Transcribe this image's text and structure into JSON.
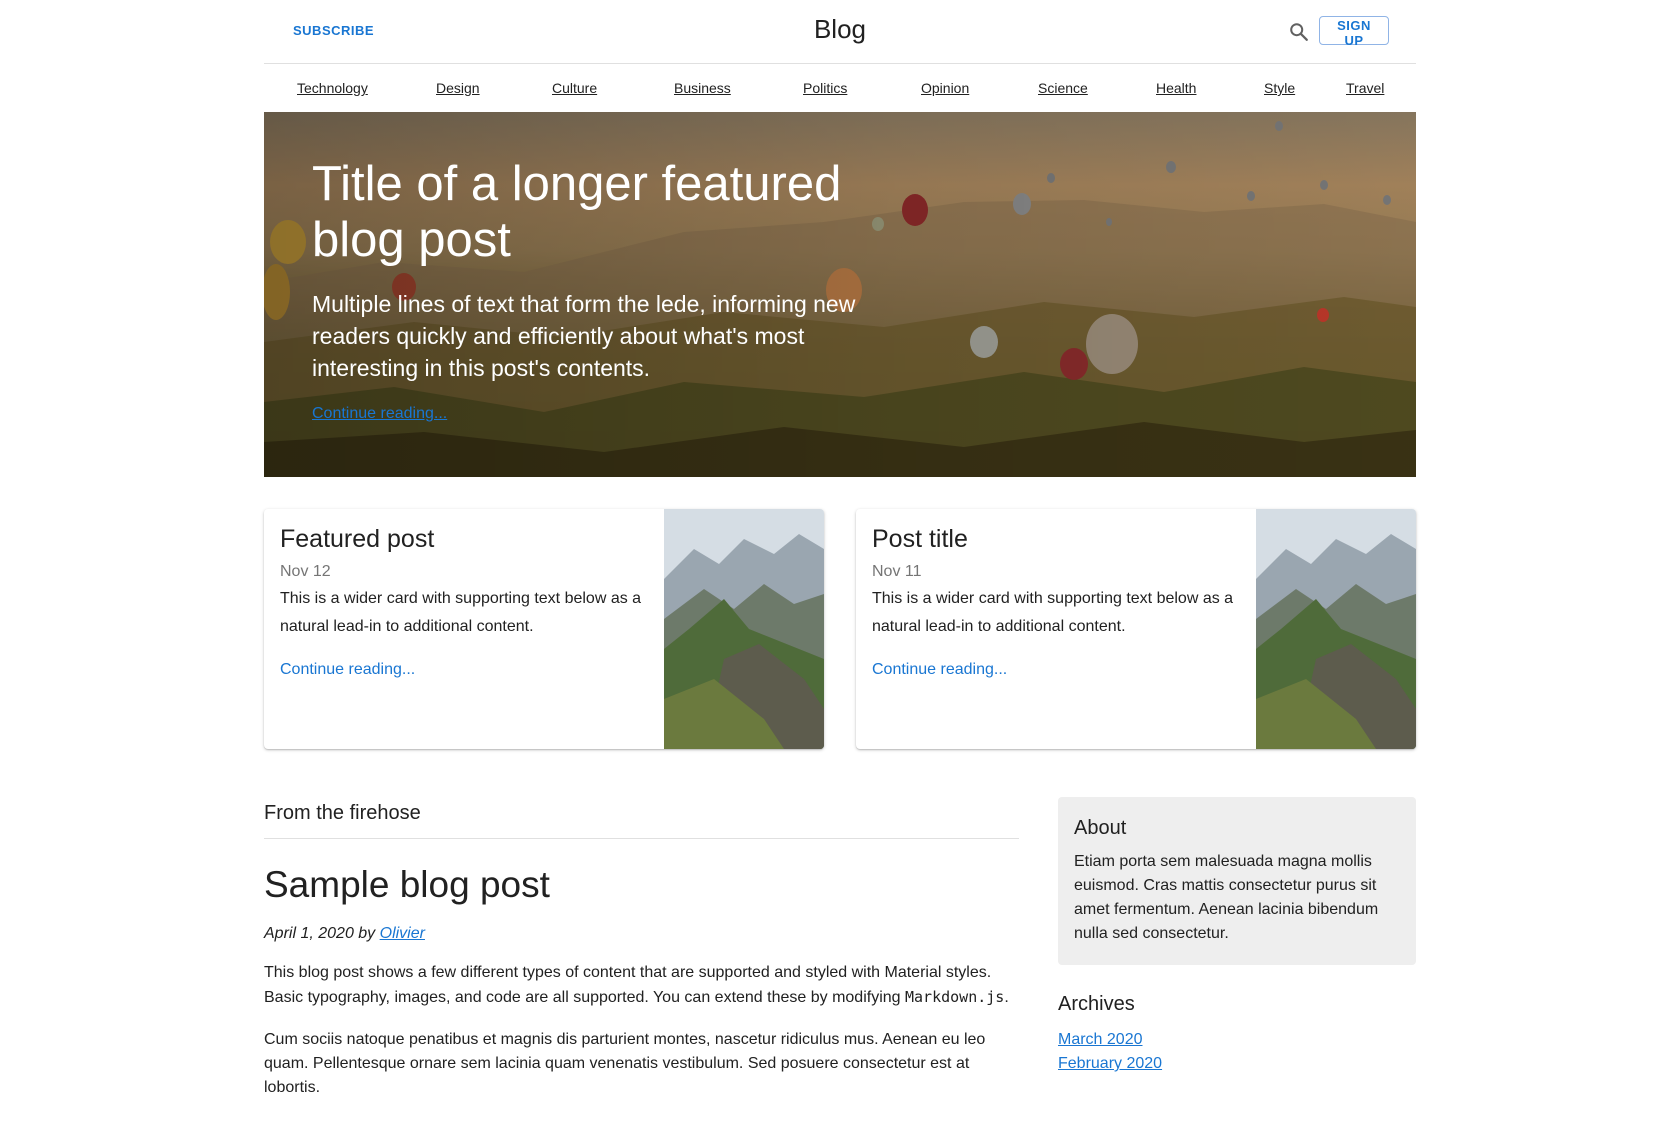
{
  "header": {
    "subscribe": "SUBSCRIBE",
    "title": "Blog",
    "signup": "SIGN UP"
  },
  "nav": {
    "items": [
      "Technology",
      "Design",
      "Culture",
      "Business",
      "Politics",
      "Opinion",
      "Science",
      "Health",
      "Style",
      "Travel"
    ]
  },
  "hero": {
    "title": "Title of a longer featured blog post",
    "lede": "Multiple lines of text that form the lede, informing new readers quickly and efficiently about what's most interesting in this post's contents.",
    "link": "Continue reading..."
  },
  "cards": [
    {
      "title": "Featured post",
      "date": "Nov 12",
      "text": "This is a wider card with supporting text below as a natural lead-in to additional content.",
      "link": "Continue reading..."
    },
    {
      "title": "Post title",
      "date": "Nov 11",
      "text": "This is a wider card with supporting text below as a natural lead-in to additional content.",
      "link": "Continue reading..."
    }
  ],
  "main": {
    "section_title": "From the firehose",
    "post": {
      "title": "Sample blog post",
      "meta_prefix": "April 1, 2020 by ",
      "author": "Olivier",
      "p1_text": "This blog post shows a few different types of content that are supported and styled with Material styles. Basic typography, images, and code are all supported. You can extend these by modifying ",
      "p1_code": "Markdown.js",
      "p1_end": ".",
      "p2": "Cum sociis natoque penatibus et magnis dis parturient montes, nascetur ridiculus mus. Aenean eu leo quam. Pellentesque ornare sem lacinia quam venenatis vestibulum. Sed posuere consectetur est at lobortis."
    }
  },
  "sidebar": {
    "about_title": "About",
    "about_text": "Etiam porta sem malesuada magna mollis euismod. Cras mattis consectetur purus sit amet fermentum. Aenean lacinia bibendum nulla sed consectetur.",
    "archives_title": "Archives",
    "archives": [
      "March 2020",
      "February 2020"
    ]
  },
  "colors": {
    "accent": "#1976d2",
    "text": "#212121",
    "muted": "#757575",
    "sidebar_bg": "#eeeeee"
  },
  "icons": {
    "search": "search-icon"
  }
}
